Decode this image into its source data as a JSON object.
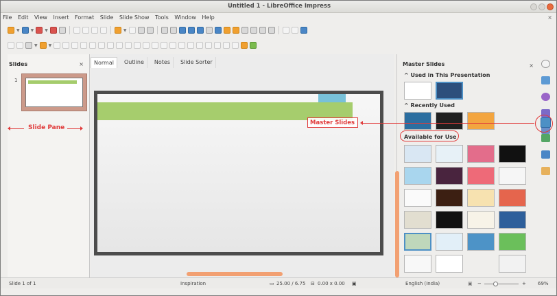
{
  "window": {
    "title": "Untitled 1 - LibreOffice Impress"
  },
  "menu": [
    "File",
    "Edit",
    "View",
    "Insert",
    "Format",
    "Slide",
    "Slide Show",
    "Tools",
    "Window",
    "Help"
  ],
  "panes": {
    "slides": {
      "title": "Slides",
      "close": "×",
      "thumbnail_number": "1"
    },
    "edit_tabs": [
      "Normal",
      "Outline",
      "Notes",
      "Slide Sorter"
    ],
    "master_slides": {
      "title": "Master Slides",
      "close": "×",
      "sections": {
        "used": "^ Used in This Presentation",
        "recent": "^ Recently Used",
        "available": "Available for Use"
      }
    }
  },
  "status": {
    "slide": "Slide 1 of 1",
    "master": "Inspiration",
    "position": "25.00 / 6.75",
    "size": "0.00 x 0.00",
    "language": "English (India)",
    "zoom": "69%"
  },
  "annotations": {
    "slide_pane": "Slide Pane",
    "master_slides": "Master Slides"
  },
  "icons": {
    "toolbar": [
      "new-icon",
      "open-icon",
      "save-icon",
      "export-pdf-icon",
      "print-icon",
      "cut-icon",
      "copy-icon",
      "paste-icon",
      "clone-icon",
      "undo-icon",
      "redo-icon",
      "find-icon",
      "spelling-icon",
      "grid-icon",
      "display-views-icon",
      "master-slide-icon",
      "start-first-icon",
      "start-current-icon",
      "table-icon",
      "image-icon",
      "media-icon",
      "chart-icon",
      "text-box-icon",
      "fontwork-icon",
      "hyperlink-icon",
      "draw-icon"
    ]
  }
}
